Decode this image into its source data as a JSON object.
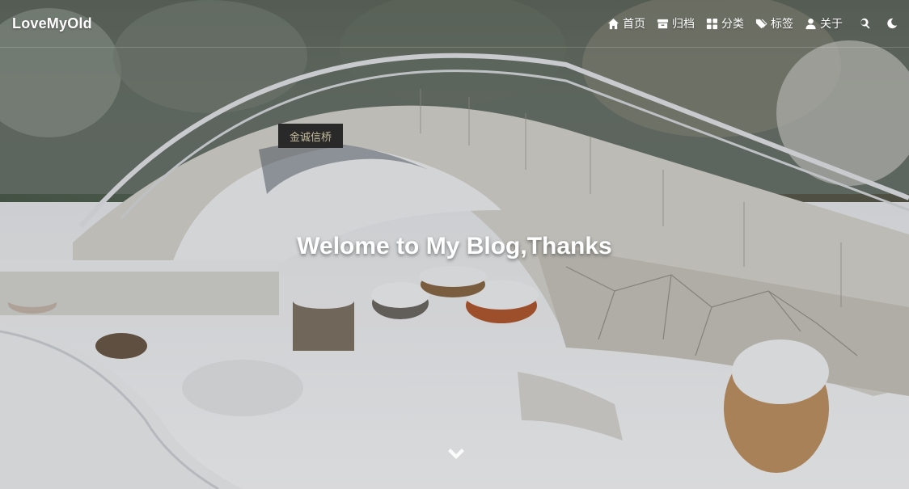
{
  "site": {
    "brand": "LoveMyOld"
  },
  "nav": {
    "items": [
      {
        "label": "首页",
        "icon": "home-icon"
      },
      {
        "label": "归档",
        "icon": "archive-icon"
      },
      {
        "label": "分类",
        "icon": "grid-icon"
      },
      {
        "label": "标签",
        "icon": "tags-icon"
      },
      {
        "label": "关于",
        "icon": "user-icon"
      }
    ],
    "search_icon": "search-icon",
    "theme_icon": "moon-icon"
  },
  "hero": {
    "title": "Welome to My Blog,Thanks",
    "sign_text": "金诚信桥",
    "scroll_icon": "chevron-down-icon"
  }
}
